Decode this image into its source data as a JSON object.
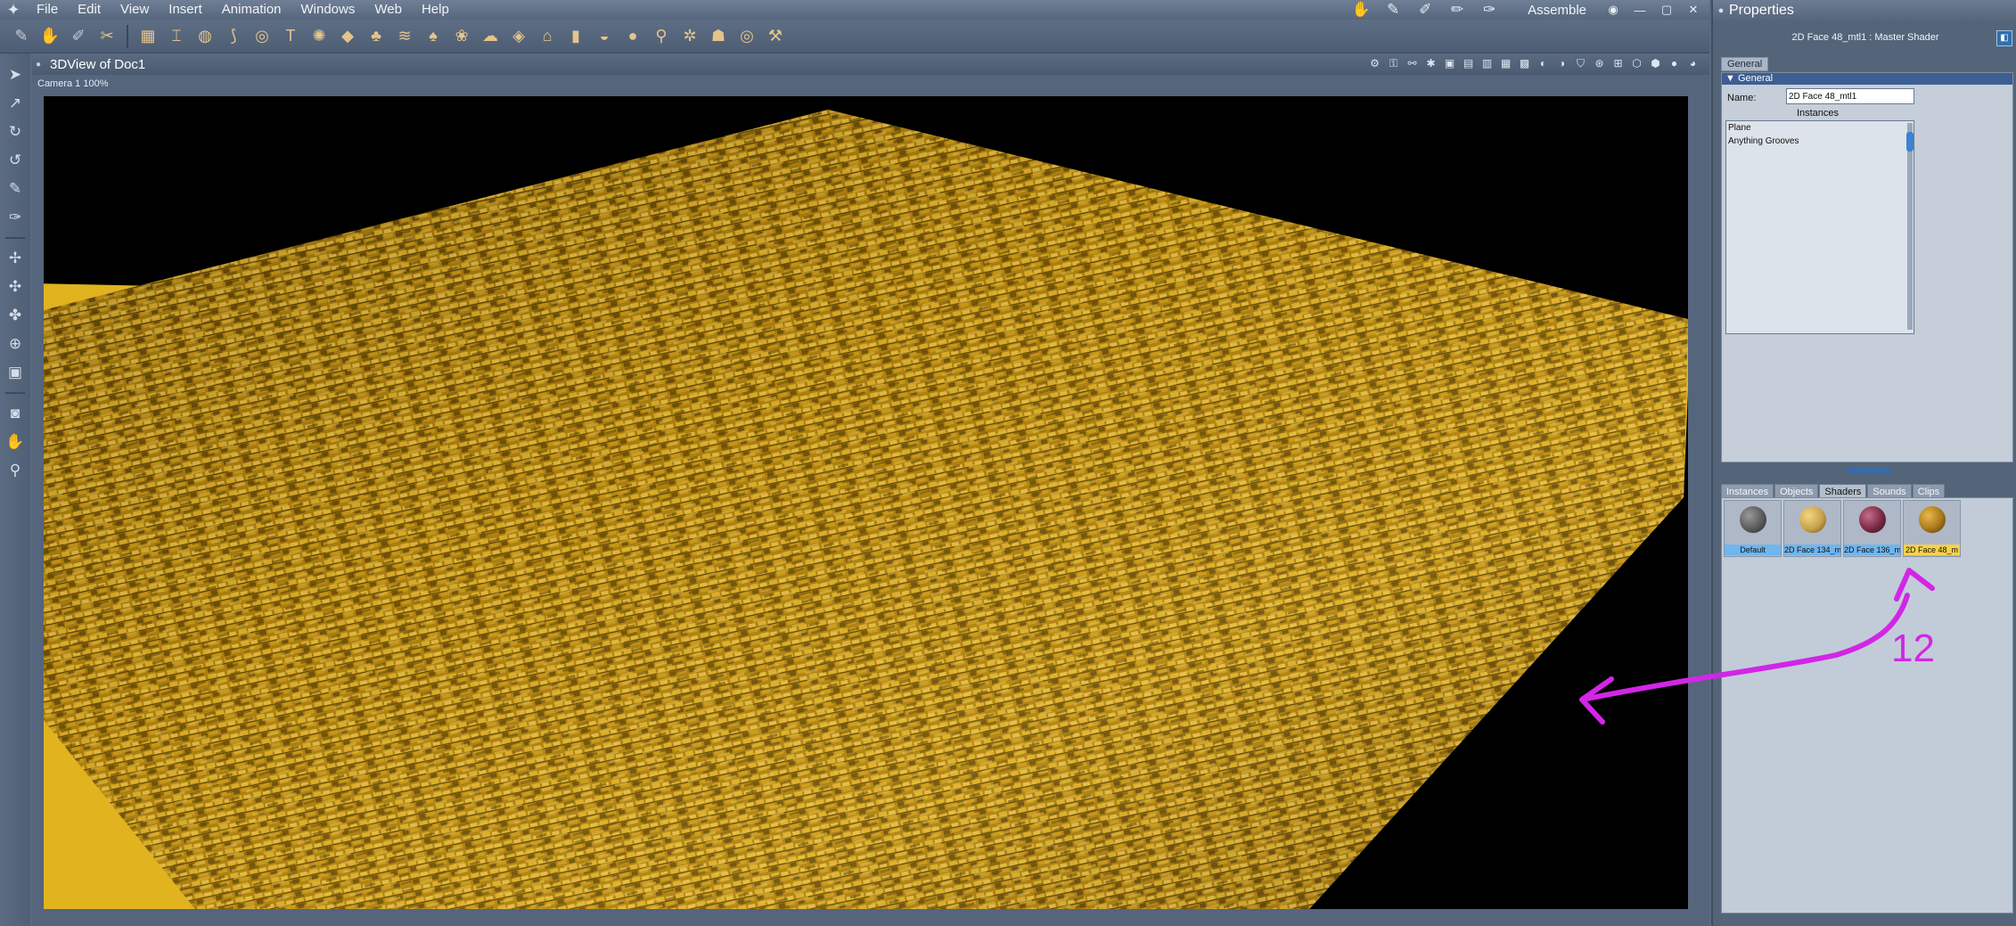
{
  "menu": {
    "items": [
      "File",
      "Edit",
      "View",
      "Insert",
      "Animation",
      "Windows",
      "Web",
      "Help"
    ],
    "room": "Assemble"
  },
  "viewport": {
    "title": "3DView of Doc1",
    "camera": "Camera 1 100%"
  },
  "properties": {
    "panel_title": "Properties",
    "shader_title": "2D Face 48_mtl1 : Master Shader",
    "tab": "General",
    "section": "General",
    "name_label": "Name:",
    "name_value": "2D Face 48_mtl1",
    "instances_label": "Instances",
    "instances": [
      "Plane",
      "Anything Grooves"
    ]
  },
  "library": {
    "tabs": [
      "Instances",
      "Objects",
      "Shaders",
      "Sounds",
      "Clips"
    ],
    "active_tab": "Shaders",
    "thumbs": [
      {
        "label": "Default",
        "color": "#6e6e6e"
      },
      {
        "label": "2D Face 134_m",
        "color": "#c9a24a"
      },
      {
        "label": "2D Face 136_m",
        "color": "#7a2a45"
      },
      {
        "label": "2D Face 48_m",
        "color": "#a8781c"
      }
    ]
  },
  "annotation": {
    "text": "12",
    "color": "#d226e6"
  },
  "colors": {
    "accent": "#3c5e93",
    "material_gold": "#c99a1c",
    "selection_yellow": "#f7d24a"
  }
}
